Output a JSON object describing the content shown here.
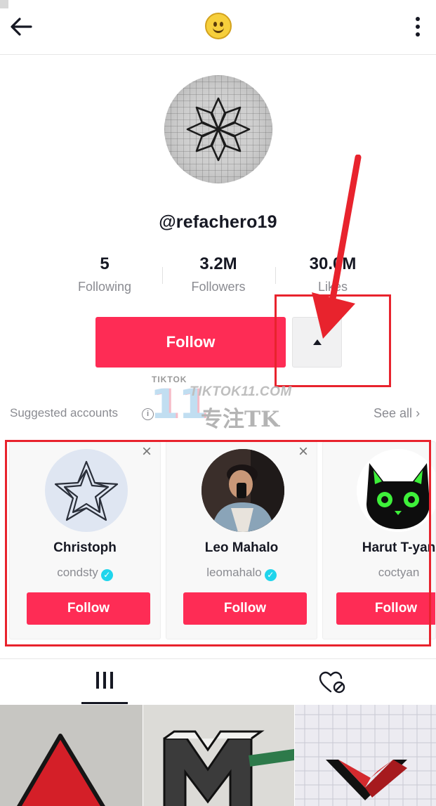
{
  "header": {
    "back_icon": "arrow-left-icon",
    "center_icon": "smiley-emoji-icon",
    "menu_icon": "more-vertical-icon"
  },
  "profile": {
    "avatar_icon": "geometric-star-drawing",
    "username": "@refachero19",
    "stats": [
      {
        "value": "5",
        "label": "Following"
      },
      {
        "value": "3.2M",
        "label": "Followers"
      },
      {
        "value": "30.0M",
        "label": "Likes"
      }
    ],
    "follow_label": "Follow",
    "dropdown_icon": "caret-up-icon"
  },
  "watermark": {
    "brand_top": "TIKTOK",
    "brand_number": "11",
    "site": "TIKTOK11.COM",
    "slogan": "专注TK"
  },
  "suggested": {
    "title": "Suggested accounts",
    "info_icon": "info-icon",
    "see_all": "See all",
    "see_all_icon": "chevron-right-icon",
    "accounts": [
      {
        "name": "Christoph",
        "handle": "condsty",
        "verified": true,
        "follow_label": "Follow"
      },
      {
        "name": "Leo Mahalo",
        "handle": "leomahalo",
        "verified": true,
        "follow_label": "Follow"
      },
      {
        "name": "Harut T-yan",
        "handle": "coctyan",
        "verified": false,
        "follow_label": "Follow"
      }
    ]
  },
  "tabs": [
    {
      "icon": "videos-grid-icon",
      "active": true
    },
    {
      "icon": "liked-hidden-heart-icon",
      "active": false
    }
  ],
  "colors": {
    "accent": "#fe2c55",
    "annotation": "#e8232d",
    "verified": "#20d5ec",
    "text_primary": "#161823",
    "text_secondary": "#8a8b91"
  }
}
